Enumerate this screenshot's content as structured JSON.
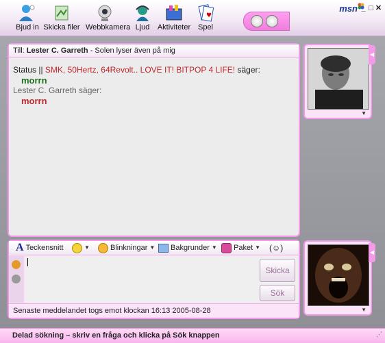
{
  "toolbar": {
    "items": [
      {
        "label": "Bjud in",
        "icon": "invite-buddy-icon"
      },
      {
        "label": "Skicka filer",
        "icon": "send-files-icon"
      },
      {
        "label": "Webbkamera",
        "icon": "webcam-icon"
      },
      {
        "label": "Ljud",
        "icon": "audio-icon"
      },
      {
        "label": "Aktiviteter",
        "icon": "activities-icon"
      },
      {
        "label": "Spel",
        "icon": "games-icon"
      }
    ],
    "brand": "msn"
  },
  "conversation": {
    "to_prefix": "Till:",
    "to_name": "Lester C. Garreth",
    "to_status": "- Solen lyser även på mig",
    "messages": [
      {
        "sender_prefix": "Status || ",
        "sender_name": "SMK, 50Hertz, 64Revolt.. LOVE IT! BITPOP 4 LIFE!",
        "says": " säger:",
        "text": "morrn",
        "color": "#1b6f1b"
      },
      {
        "sender_prefix": "",
        "sender_name": "Lester C. Garreth",
        "says": " säger:",
        "text": "morrn",
        "color": "#c0262b"
      }
    ]
  },
  "compose": {
    "font_label": "Teckensnitt",
    "winks_label": "Blinkningar",
    "backgrounds_label": "Bakgrunder",
    "packs_label": "Paket",
    "send_label": "Skicka",
    "search_label": "Sök",
    "status": "Senaste meddelandet togs emot klockan 16:13 2005-08-28"
  },
  "search_bar": "Delad sökning – skriv en fråga och klicka på Sök knappen",
  "colors": {
    "accent": "#f39ae9",
    "panel_bg": "#fbe4f8",
    "green": "#1b6f1b",
    "red": "#c0262b"
  }
}
